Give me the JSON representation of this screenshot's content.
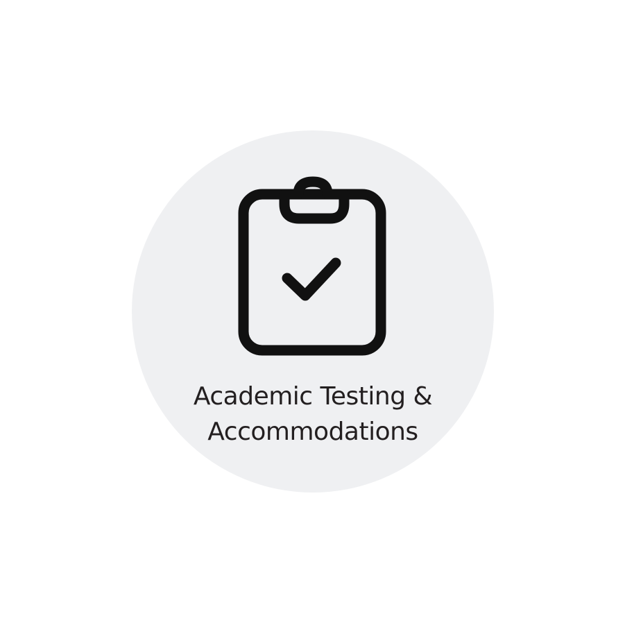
{
  "tile": {
    "title_lines": [
      "Academic Testing &",
      "Accommodations"
    ],
    "icon": "clipboard-check-icon"
  },
  "colors": {
    "page_background": "#ffffff",
    "circle_background": "#eff0f2",
    "icon_stroke": "#111111",
    "text": "#231f20"
  }
}
